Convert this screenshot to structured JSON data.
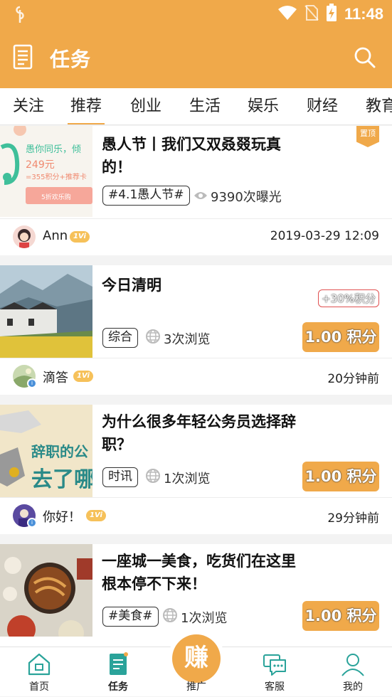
{
  "status": {
    "time": "11:48"
  },
  "header": {
    "title": "任务"
  },
  "tabs": [
    "关注",
    "推荐",
    "创业",
    "生活",
    "娱乐",
    "财经",
    "教育"
  ],
  "active_tab": "推荐",
  "cards": [
    {
      "title": "愚人节丨我们又双叒叕玩真的！",
      "tag": "#4.1愚人节#",
      "views": "9390次曝光",
      "pinned": "置顶",
      "author": "Ann",
      "level": "1Vi",
      "time": "2019-03-29 12:09",
      "thumb_text": {
        "line1": "愚你同乐，倾",
        "line2": "249元",
        "line3": "=355积分+推荐卡",
        "line4": "5折欢乐购"
      }
    },
    {
      "title": "今日清明",
      "bonus": "+30%积分",
      "tag": "综合",
      "views": "3次浏览",
      "points": "1.00 积分",
      "author": "滴答",
      "level": "1Vi",
      "time": "20分钟前"
    },
    {
      "title": "为什么很多年轻公务员选择辞职？",
      "tag": "时讯",
      "views": "1次浏览",
      "points": "1.00 积分",
      "author": "你好！",
      "level": "1Vi",
      "time": "29分钟前",
      "thumb_text": {
        "line1": "辞职的公",
        "line2": "去了哪"
      }
    },
    {
      "title": "一座城一美食，吃货们在这里根本停不下来！",
      "tag": "#美食#",
      "views": "1次浏览",
      "points": "1.00 积分"
    }
  ],
  "bottom_nav": {
    "home": "首页",
    "tasks": "任务",
    "earn": "赚",
    "promote": "推广",
    "service": "客服",
    "mine": "我的"
  },
  "colors": {
    "accent": "#f0a94a",
    "bonus_border": "#e05050",
    "level_badge": "#f6c15a"
  }
}
